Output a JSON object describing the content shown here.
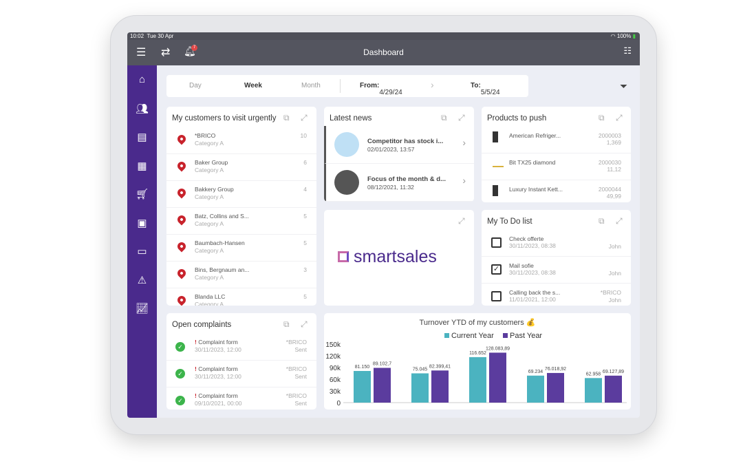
{
  "status": {
    "time": "10:02",
    "date": "Tue 30 Apr",
    "battery": "100%"
  },
  "header": {
    "title": "Dashboard",
    "notification_count": "7"
  },
  "filter": {
    "periods": [
      "Day",
      "Week",
      "Month"
    ],
    "active": "Week",
    "from_label": "From:",
    "from": "4/29/24",
    "to_label": "To:",
    "to": "5/5/24"
  },
  "customers": {
    "title": "My customers to visit urgently",
    "items": [
      {
        "name": "*BRICO",
        "category": "Category A",
        "count": "10"
      },
      {
        "name": "Baker Group",
        "category": "Category A",
        "count": "6"
      },
      {
        "name": "Bakkery Group",
        "category": "Category A",
        "count": "4"
      },
      {
        "name": "Batz, Collins and S...",
        "category": "Category A",
        "count": "5"
      },
      {
        "name": "Baumbach-Hansen",
        "category": "Category A",
        "count": "5"
      },
      {
        "name": "Bins, Bergnaum an...",
        "category": "Category A",
        "count": "3"
      },
      {
        "name": "Blanda LLC",
        "category": "Category A",
        "count": "5"
      }
    ]
  },
  "news": {
    "title": "Latest news",
    "items": [
      {
        "title": "Competitor has stock i...",
        "date": "02/01/2023, 13:57"
      },
      {
        "title": "Focus of the month & d...",
        "date": "08/12/2021, 11:32"
      }
    ]
  },
  "products": {
    "title": "Products to push",
    "items": [
      {
        "name": "American Refriger...",
        "code": "2000003",
        "price": "1,369"
      },
      {
        "name": "Bit TX25 diamond",
        "code": "2000030",
        "price": "11,12"
      },
      {
        "name": "Luxury Instant Kett...",
        "code": "2000044",
        "price": "49,99"
      }
    ]
  },
  "logo": {
    "text": "smartsales"
  },
  "todo": {
    "title": "My To Do list",
    "items": [
      {
        "title": "Check offerte",
        "date": "30/11/2023, 08:38",
        "customer": "",
        "user": "John",
        "checked": false
      },
      {
        "title": "Mail sofie",
        "date": "30/11/2023, 08:38",
        "customer": "",
        "user": "John",
        "checked": true
      },
      {
        "title": "Calling back the s...",
        "date": "11/01/2021, 12:00",
        "customer": "*BRICO",
        "user": "John",
        "checked": false
      }
    ]
  },
  "complaints": {
    "title": "Open complaints",
    "items": [
      {
        "title": "Complaint form",
        "date": "30/11/2023, 12:00",
        "customer": "*BRICO",
        "status": "Sent"
      },
      {
        "title": "Complaint form",
        "date": "30/11/2023, 12:00",
        "customer": "*BRICO",
        "status": "Sent"
      },
      {
        "title": "Complaint form",
        "date": "09/10/2021, 00:00",
        "customer": "*BRICO",
        "status": "Sent"
      }
    ]
  },
  "chart_data": {
    "type": "bar",
    "title": "Turnover YTD of my customers 💰",
    "ylim": [
      0,
      150000
    ],
    "yticks": [
      "0",
      "30k",
      "60k",
      "90k",
      "120k",
      "150k"
    ],
    "legend": "top",
    "series": [
      {
        "name": "Current Year",
        "color": "#4bb3c0",
        "values": [
          81150,
          75045,
          116652,
          69234,
          62958
        ],
        "labels": [
          "81.150",
          "75.045",
          "116.652",
          "69.234",
          "62.958"
        ]
      },
      {
        "name": "Past Year",
        "color": "#5b3c9e",
        "values": [
          89102.7,
          82399.41,
          128083.89,
          76018.92,
          69127.89
        ],
        "labels": [
          "89.102,7",
          "82.399,41",
          "128.083,89",
          "76.018,92",
          "69.127,89"
        ]
      }
    ]
  }
}
